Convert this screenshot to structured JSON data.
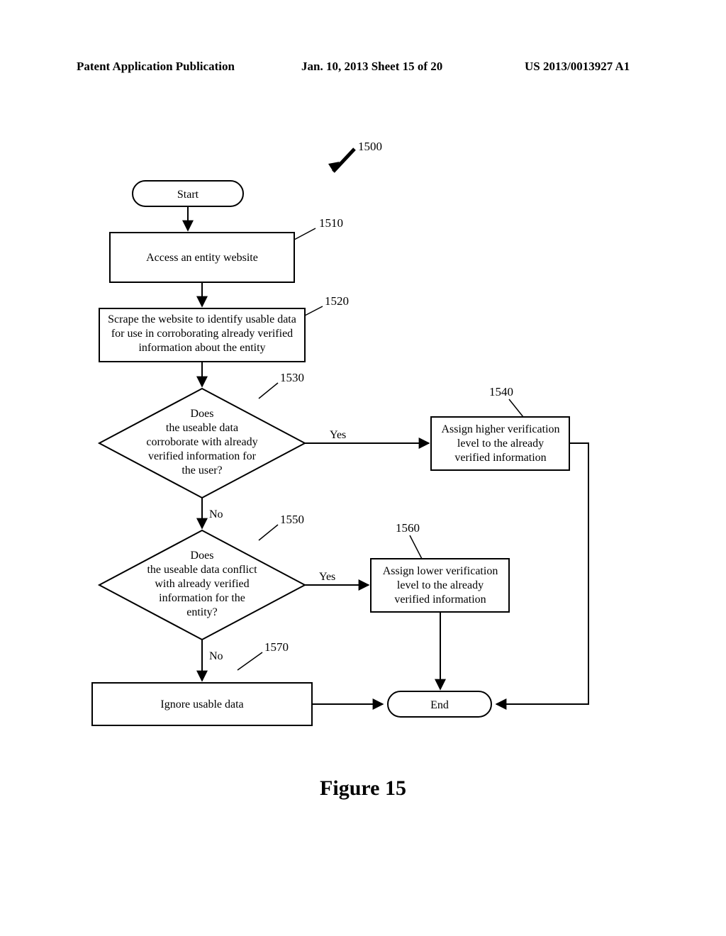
{
  "header": {
    "left": "Patent Application Publication",
    "center": "Jan. 10, 2013  Sheet 15 of 20",
    "right": "US 2013/0013927 A1"
  },
  "figure_title": "Figure 15",
  "refs": {
    "r1500": "1500",
    "r1510": "1510",
    "r1520": "1520",
    "r1530": "1530",
    "r1540": "1540",
    "r1550": "1550",
    "r1560": "1560",
    "r1570": "1570"
  },
  "nodes": {
    "start": "Start",
    "end": "End",
    "b1510": "Access an entity website",
    "b1520_l1": "Scrape the website to identify usable data",
    "b1520_l2": "for use in corroborating already verified",
    "b1520_l3": "information about the entity",
    "d1530_l1": "Does",
    "d1530_l2": "the useable data",
    "d1530_l3": "corroborate with already",
    "d1530_l4": "verified information for",
    "d1530_l5": "the user?",
    "b1540_l1": "Assign higher verification",
    "b1540_l2": "level to the already",
    "b1540_l3": "verified information",
    "d1550_l1": "Does",
    "d1550_l2": "the useable data conflict",
    "d1550_l3": "with already verified",
    "d1550_l4": "information for the",
    "d1550_l5": "entity?",
    "b1560_l1": "Assign lower verification",
    "b1560_l2": "level to the already",
    "b1560_l3": "verified information",
    "b1570": "Ignore usable data"
  },
  "edges": {
    "yes": "Yes",
    "no": "No"
  }
}
